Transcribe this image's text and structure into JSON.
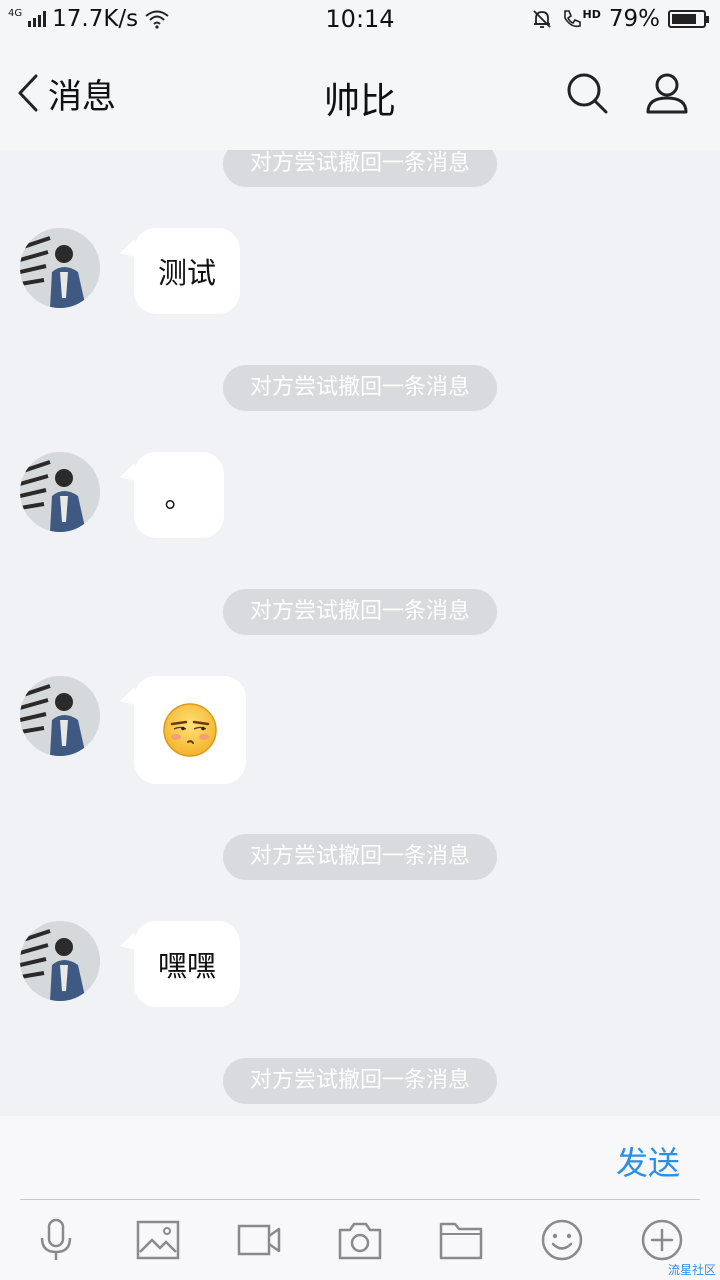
{
  "status_bar": {
    "network": "4G",
    "speed": "17.7K/s",
    "time": "10:14",
    "hd_label": "HD",
    "battery": "79%",
    "battery_level": 0.79
  },
  "nav": {
    "back_label": "消息",
    "title": "帅比"
  },
  "chat": {
    "recall_notice": "对方尝试撤回一条消息",
    "messages": [
      {
        "type": "text",
        "text": "测试"
      },
      {
        "type": "text",
        "text": "。"
      },
      {
        "type": "emoji",
        "icon": "smirk-emoji-icon"
      },
      {
        "type": "text",
        "text": "嘿嘿"
      }
    ]
  },
  "input": {
    "send_label": "发送"
  },
  "toolbar": {
    "items": [
      "microphone-icon",
      "image-icon",
      "video-icon",
      "camera-icon",
      "folder-icon",
      "smiley-icon",
      "plus-icon"
    ]
  },
  "watermark": "流星社区",
  "colors": {
    "accent": "#2a8fe6",
    "chat_bg": "#f1f2f5",
    "pill_bg": "#d9dadd"
  }
}
